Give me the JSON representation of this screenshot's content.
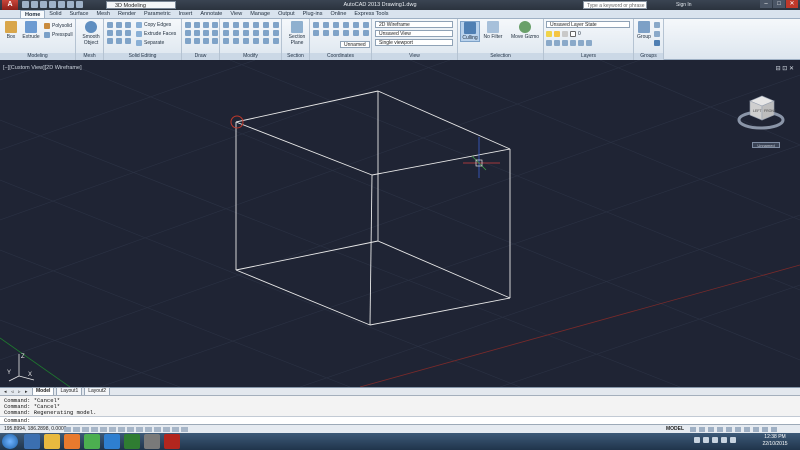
{
  "window": {
    "title": "AutoCAD 2013  Drawing1.dwg",
    "workspace": "3D Modeling",
    "search_placeholder": "Type a keyword or phrase",
    "user": "Sign In"
  },
  "ribbon_tabs": [
    "Home",
    "Solid",
    "Surface",
    "Mesh",
    "Render",
    "Parametric",
    "Insert",
    "Annotate",
    "View",
    "Manage",
    "Output",
    "Plug-ins",
    "Online",
    "Express Tools"
  ],
  "ribbon": {
    "modeling": {
      "title": "Modeling",
      "box": "Box",
      "extrude": "Extrude",
      "polysolid": "Polysolid",
      "presspull": "Presspull"
    },
    "mesh": {
      "title": "Mesh",
      "smooth_object": "Smooth Object"
    },
    "solid_editing": {
      "title": "Solid Editing",
      "copy_edges": "Copy Edges",
      "extrude_faces": "Extrude Faces",
      "separate": "Separate"
    },
    "draw": {
      "title": "Draw"
    },
    "modify": {
      "title": "Modify"
    },
    "section": {
      "title": "Section",
      "section_plane": "Section Plane"
    },
    "coordinates": {
      "title": "Coordinates",
      "ucs": "Unnamed"
    },
    "view": {
      "title": "View",
      "visual_style": "2D Wireframe",
      "view_name": "Unsaved View",
      "viewport": "Single viewport"
    },
    "selection": {
      "title": "Selection",
      "culling": "Culling",
      "no_filter": "No Filter",
      "move_gizmo": "Move Gizmo"
    },
    "layers": {
      "title": "Layers",
      "layer_state": "Unsaved Layer State",
      "current_layer": "0"
    },
    "groups": {
      "title": "Groups",
      "group": "Group"
    }
  },
  "viewport": {
    "label": "[−][Custom View][2D Wireframe]",
    "viewcube_face_front": "FRONT",
    "viewcube_face_left": "LEFT",
    "wcs_label": "Unnamed",
    "ucs_x": "X",
    "ucs_y": "Y",
    "ucs_z": "Z"
  },
  "layout_tabs": [
    "Model",
    "Layout1",
    "Layout2"
  ],
  "command_history": [
    "Command: *Cancel*",
    "Command: *Cancel*",
    "Command:  Regenerating model."
  ],
  "command_prompt": "Command:",
  "status": {
    "coords": "195.8994, 186.2898, 0.0000",
    "model": "MODEL"
  },
  "taskbar": {
    "time": "12:38 PM",
    "date": "22/10/2015"
  },
  "colors": {
    "viewport_bg": "#1f2434",
    "ribbon_bg": "#dde6ef",
    "wireframe": "#e8e8e8"
  }
}
